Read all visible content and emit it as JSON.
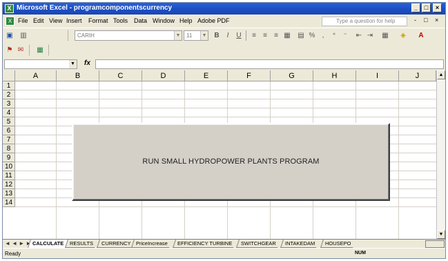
{
  "window": {
    "title": "Microsoft Excel - programcomponentscurrency",
    "min_label": "_",
    "max_label": "□",
    "close_label": "×"
  },
  "menu": {
    "items": [
      "File",
      "Edit",
      "View",
      "Insert",
      "Format",
      "Tools",
      "Data",
      "Window",
      "Help",
      "Adobe PDF"
    ],
    "help_placeholder": "Type a question for help",
    "doc_min": "-",
    "doc_restore": "□",
    "doc_close": "×"
  },
  "toolbar": {
    "font_name": "CARIH",
    "font_size": "11",
    "bold": "B",
    "italic": "I",
    "underline": "U",
    "percent": "%",
    "font_color": "A"
  },
  "formula_bar": {
    "name_box": "",
    "fx": "fx",
    "content": ""
  },
  "sheet": {
    "columns": [
      "A",
      "B",
      "C",
      "D",
      "E",
      "F",
      "G",
      "H",
      "I",
      "J"
    ],
    "rows": [
      "1",
      "2",
      "3",
      "4",
      "5",
      "6",
      "7",
      "8",
      "9",
      "10",
      "11",
      "12",
      "13",
      "14"
    ],
    "run_button_label": "RUN SMALL HYDROPOWER PLANTS PROGRAM"
  },
  "tabs": {
    "nav": "◄ ◄ ► ►",
    "items": [
      "CALCULATE",
      "RESULTS",
      "CURRENCY",
      "PriceIncrease",
      "EFFICIENCY TURBINE",
      "SWITCHGEAR",
      "INTAKEDAM",
      "HOUSEPO"
    ],
    "active_index": 0
  },
  "status": {
    "ready": "Ready",
    "num": "NUM"
  },
  "colors": {
    "title_bar": "#1d4fc4",
    "chrome": "#ece9d8",
    "button_face": "#d4d0c8",
    "gridline": "#d4d0c8"
  }
}
